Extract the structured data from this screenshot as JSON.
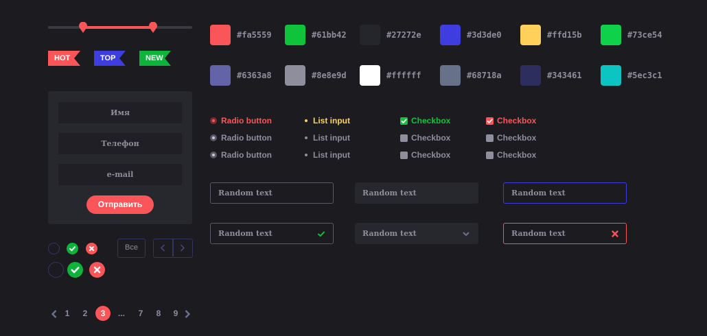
{
  "slider": {
    "min_value": 0.24,
    "max_value": 0.73
  },
  "ribbons": [
    {
      "label": "HOT",
      "color": "#fa5559"
    },
    {
      "label": "TOP",
      "color": "#3d3de0"
    },
    {
      "label": "NEW",
      "color": "#61bb42"
    }
  ],
  "form": {
    "name_placeholder": "Имя",
    "phone_placeholder": "Телефон",
    "email_placeholder": "e-mail",
    "submit_label": "Отправить"
  },
  "controls": {
    "all_button_label": "Все",
    "prev_icon": "chevron-left-icon",
    "next_icon": "chevron-right-icon"
  },
  "pagination": {
    "items": [
      "1",
      "2",
      "3",
      "...",
      "7",
      "8",
      "9"
    ],
    "active": "3"
  },
  "palette": [
    {
      "hex": "#fa5559",
      "label": "#fa5559"
    },
    {
      "hex": "#61bb42",
      "label": "#61bb42"
    },
    {
      "hex": "#27272e",
      "label": "#27272e"
    },
    {
      "hex": "#3d3de0",
      "label": "#3d3de0"
    },
    {
      "hex": "#ffd15b",
      "label": "#ffd15b"
    },
    {
      "hex": "#73ce54",
      "label": "#73ce54"
    },
    {
      "hex": "#6363a8",
      "label": "#6363a8"
    },
    {
      "hex": "#8e8e9d",
      "label": "#8e8e9d"
    },
    {
      "hex": "#ffffff",
      "label": "#ffffff"
    },
    {
      "hex": "#68718a",
      "label": "#68718a"
    },
    {
      "hex": "#343461",
      "label": "#343461"
    },
    {
      "hex": "#5ec3c1",
      "label": "#5ec3c1"
    }
  ],
  "radios": {
    "items": [
      "Radio button",
      "Radio button",
      "Radio button"
    ],
    "active_color": "#fa5559"
  },
  "lists": {
    "items": [
      "List input",
      "List input",
      "List input"
    ],
    "active_color": "#ffd15b"
  },
  "checkboxes_green": {
    "items": [
      "Checkbox",
      "Checkbox",
      "Checkbox"
    ],
    "active_color": "#61bb42"
  },
  "checkboxes_red": {
    "items": [
      "Checkbox",
      "Checkbox",
      "Checkbox"
    ],
    "active_color": "#fa5559"
  },
  "inputs": {
    "placeholder": "Random text",
    "states": [
      "default",
      "filled",
      "focus",
      "valid",
      "select",
      "error"
    ]
  },
  "colors": {
    "background": "#1b1b20",
    "panel": "#27272e",
    "accent_red": "#fa5559",
    "accent_green": "#61bb42",
    "accent_blue": "#3d3de0",
    "accent_yellow": "#ffd15b",
    "muted_text": "#8e8e9d",
    "outline": "#343461"
  }
}
